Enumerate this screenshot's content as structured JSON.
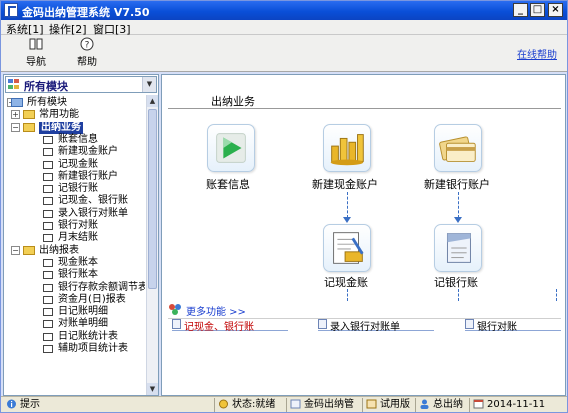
{
  "window": {
    "title": "金码出纳管理系统 V7.50"
  },
  "menubar": {
    "items": [
      "系统[1]",
      "操作[2]",
      "窗口[3]"
    ]
  },
  "toolbar": {
    "nav_label": "导航",
    "help_label": "帮助",
    "online_help": "在线帮助"
  },
  "left_panel": {
    "combo_value": "所有模块",
    "tree": [
      {
        "label": "所有模块",
        "level": 0,
        "type": "root",
        "expanded": true
      },
      {
        "label": "常用功能",
        "level": 1,
        "type": "group",
        "expanded": false
      },
      {
        "label": "出纳业务",
        "level": 1,
        "type": "group",
        "expanded": true,
        "selected": true
      },
      {
        "label": "账套信息",
        "level": 2,
        "type": "leaf"
      },
      {
        "label": "新建现金账户",
        "level": 2,
        "type": "leaf"
      },
      {
        "label": "记现金账",
        "level": 2,
        "type": "leaf"
      },
      {
        "label": "新建银行账户",
        "level": 2,
        "type": "leaf"
      },
      {
        "label": "记银行账",
        "level": 2,
        "type": "leaf"
      },
      {
        "label": "记现金、银行账",
        "level": 2,
        "type": "leaf"
      },
      {
        "label": "录入银行对账单",
        "level": 2,
        "type": "leaf"
      },
      {
        "label": "银行对账",
        "level": 2,
        "type": "leaf"
      },
      {
        "label": "月末结账",
        "level": 2,
        "type": "leaf"
      },
      {
        "label": "出纳报表",
        "level": 1,
        "type": "group",
        "expanded": true
      },
      {
        "label": "现金账本",
        "level": 2,
        "type": "leaf"
      },
      {
        "label": "银行账本",
        "level": 2,
        "type": "leaf"
      },
      {
        "label": "银行存款余额调节表",
        "level": 2,
        "type": "leaf"
      },
      {
        "label": "资金月(日)报表",
        "level": 2,
        "type": "leaf"
      },
      {
        "label": "日记账明细",
        "level": 2,
        "type": "leaf"
      },
      {
        "label": "对账单明细",
        "level": 2,
        "type": "leaf"
      },
      {
        "label": "日记账统计表",
        "level": 2,
        "type": "leaf"
      },
      {
        "label": "辅助项目统计表",
        "level": 2,
        "type": "leaf"
      }
    ]
  },
  "main": {
    "section_title": "出纳业务",
    "tiles": [
      {
        "label": "账套信息",
        "icon": "play-arrow-icon"
      },
      {
        "label": "新建现金账户",
        "icon": "coins-icon"
      },
      {
        "label": "新建银行账户",
        "icon": "bank-card-icon"
      },
      {
        "label": "记现金账",
        "icon": "cash-ledger-icon"
      },
      {
        "label": "记银行账",
        "icon": "bank-ledger-icon"
      }
    ],
    "more_label": "更多功能 >>",
    "quick_links": [
      {
        "label": "记现金、银行账",
        "color": "#c00000"
      },
      {
        "label": "录入银行对账单",
        "color": "#000000"
      },
      {
        "label": "银行对账",
        "color": "#000000"
      }
    ]
  },
  "statusbar": {
    "hint": "提示",
    "state": "状态:就绪",
    "product": "金码出纳管",
    "edition": "试用版",
    "role": "总出纳",
    "date": "2014-11-11"
  },
  "colors": {
    "titlebar": "#0a4fd8",
    "selection": "#1f3fa0",
    "link": "#1a3ecf",
    "accent_red": "#c00000"
  }
}
